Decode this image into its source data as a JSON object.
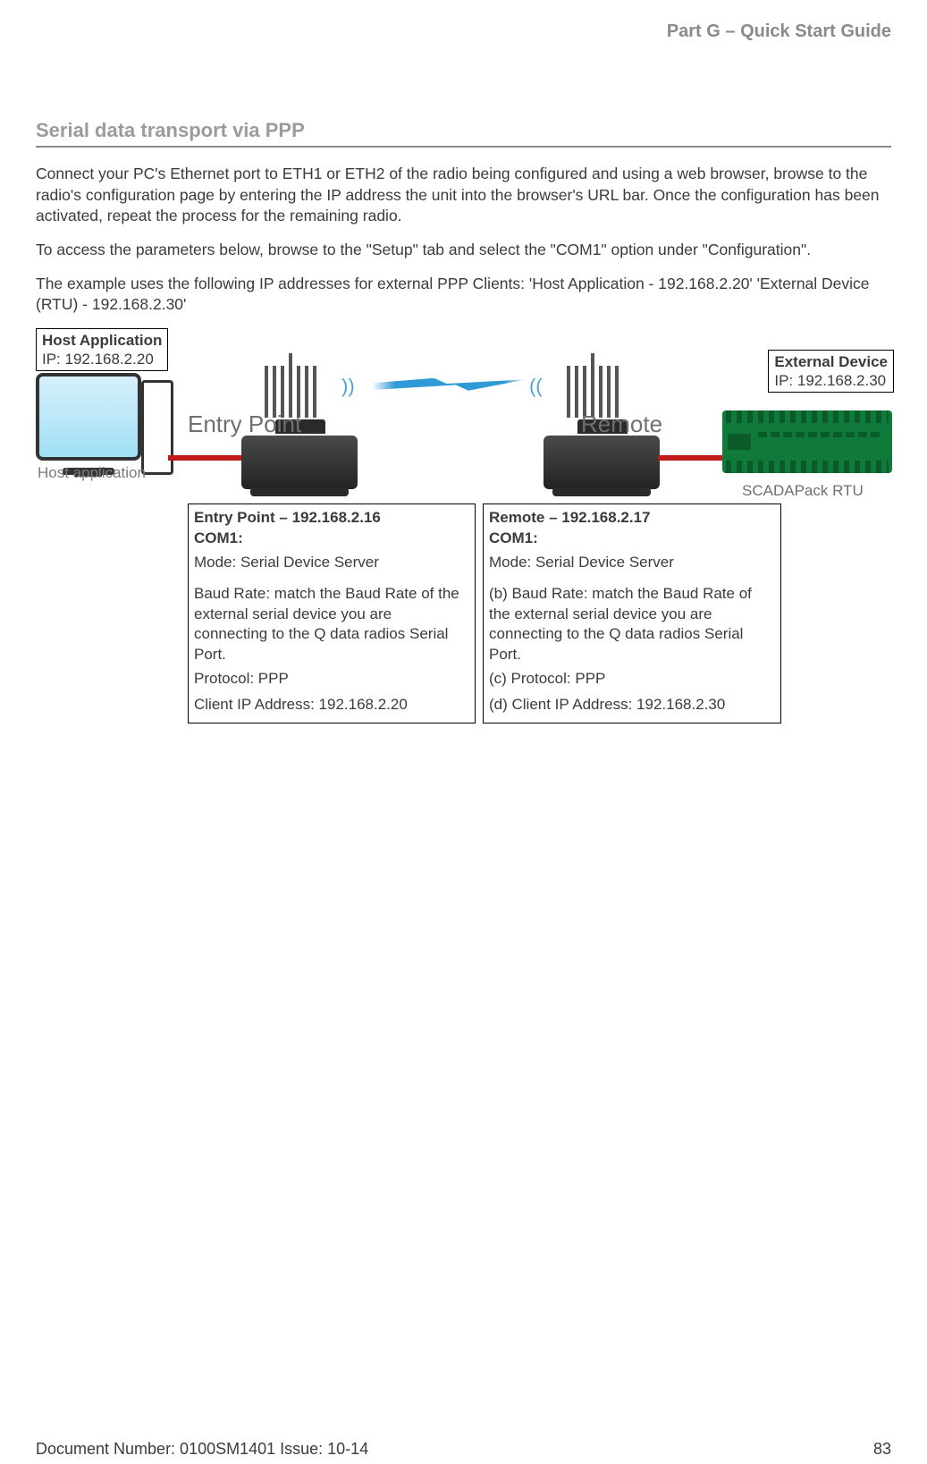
{
  "header": {
    "part": "Part G – Quick Start Guide"
  },
  "section": {
    "title": "Serial data transport via PPP"
  },
  "paragraphs": {
    "p1": "Connect your PC's Ethernet port to ETH1 or ETH2 of the radio being configured and using a web browser, browse to the radio's configuration page by entering the IP address the unit into the browser's URL bar.  Once the configuration has been activated, repeat the process for the remaining radio.",
    "p2": "To access the parameters below, browse to the \"Setup\" tab and select the \"COM1\" option under \"Configuration\".",
    "p3": "The example uses the following IP addresses for external PPP Clients: 'Host Application - 192.168.2.20' 'External Device (RTU) - 192.168.2.30'"
  },
  "diagram": {
    "host_app": {
      "title": "Host Application",
      "ip_line": "IP: 192.168.2.20",
      "caption": "Host application"
    },
    "external_device": {
      "title": "External Device",
      "ip_line": "IP: 192.168.2.30"
    },
    "entry_label": "Entry Point",
    "remote_label": "Remote",
    "rtu_caption": "SCADAPack RTU",
    "entry_cfg": {
      "header": "Entry Point – 192.168.2.16",
      "com": "COM1:",
      "mode": "Mode: Serial Device Server",
      "baud": "Baud Rate: match the Baud Rate of the external serial device you are connecting to the Q data radios Serial Port.",
      "protocol": "Protocol: PPP",
      "client_ip": "Client IP Address: 192.168.2.20"
    },
    "remote_cfg": {
      "header": "Remote – 192.168.2.17",
      "com": "COM1:",
      "mode": "Mode: Serial Device Server",
      "baud": "(b) Baud Rate: match the Baud Rate of the external serial device you are connecting to the Q data radios Serial Port.",
      "protocol": "(c) Protocol: PPP",
      "client_ip": "(d) Client IP Address: 192.168.2.30"
    }
  },
  "footer": {
    "doc": "Document Number: 0100SM1401   Issue: 10-14",
    "page": "83"
  }
}
